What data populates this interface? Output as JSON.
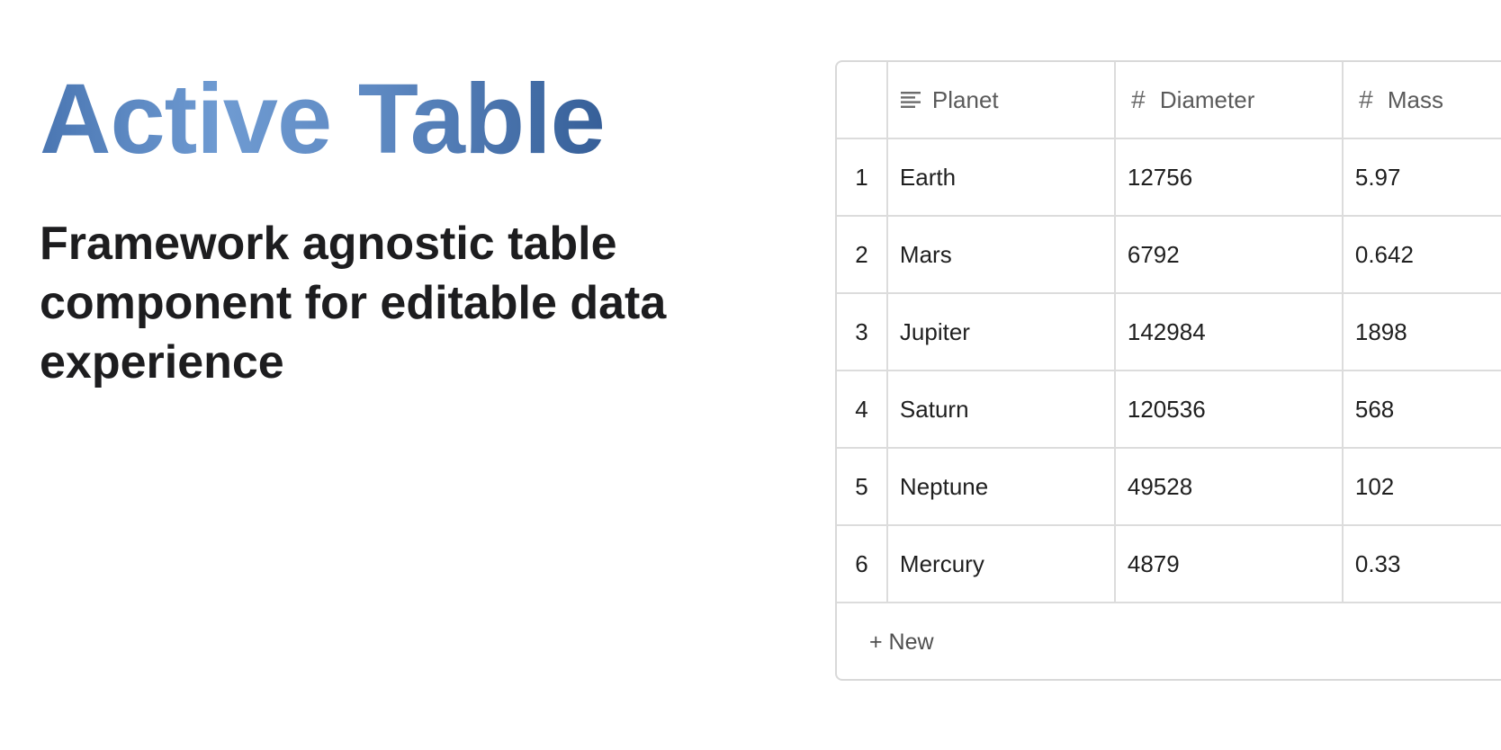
{
  "hero": {
    "title": "Active Table",
    "subtitle": "Framework agnostic table component for editable data experience"
  },
  "table": {
    "columns": [
      {
        "label": "Planet",
        "icon": "text-lines-icon"
      },
      {
        "label": "Diameter",
        "icon": "hash-icon"
      },
      {
        "label": "Mass",
        "icon": "hash-icon"
      }
    ],
    "rows": [
      {
        "index": "1",
        "planet": "Earth",
        "diameter": "12756",
        "mass": "5.97"
      },
      {
        "index": "2",
        "planet": "Mars",
        "diameter": "6792",
        "mass": "0.642"
      },
      {
        "index": "3",
        "planet": "Jupiter",
        "diameter": "142984",
        "mass": "1898"
      },
      {
        "index": "4",
        "planet": "Saturn",
        "diameter": "120536",
        "mass": "568"
      },
      {
        "index": "5",
        "planet": "Neptune",
        "diameter": "49528",
        "mass": "102"
      },
      {
        "index": "6",
        "planet": "Mercury",
        "diameter": "4879",
        "mass": "0.33"
      }
    ],
    "new_row_label": "+ New"
  },
  "colors": {
    "title_gradient_start": "#4a76b2",
    "title_gradient_mid": "#6f9bd2",
    "title_gradient_end": "#365f98",
    "subtitle": "#1d1d1f",
    "border": "#dcdcdc"
  }
}
